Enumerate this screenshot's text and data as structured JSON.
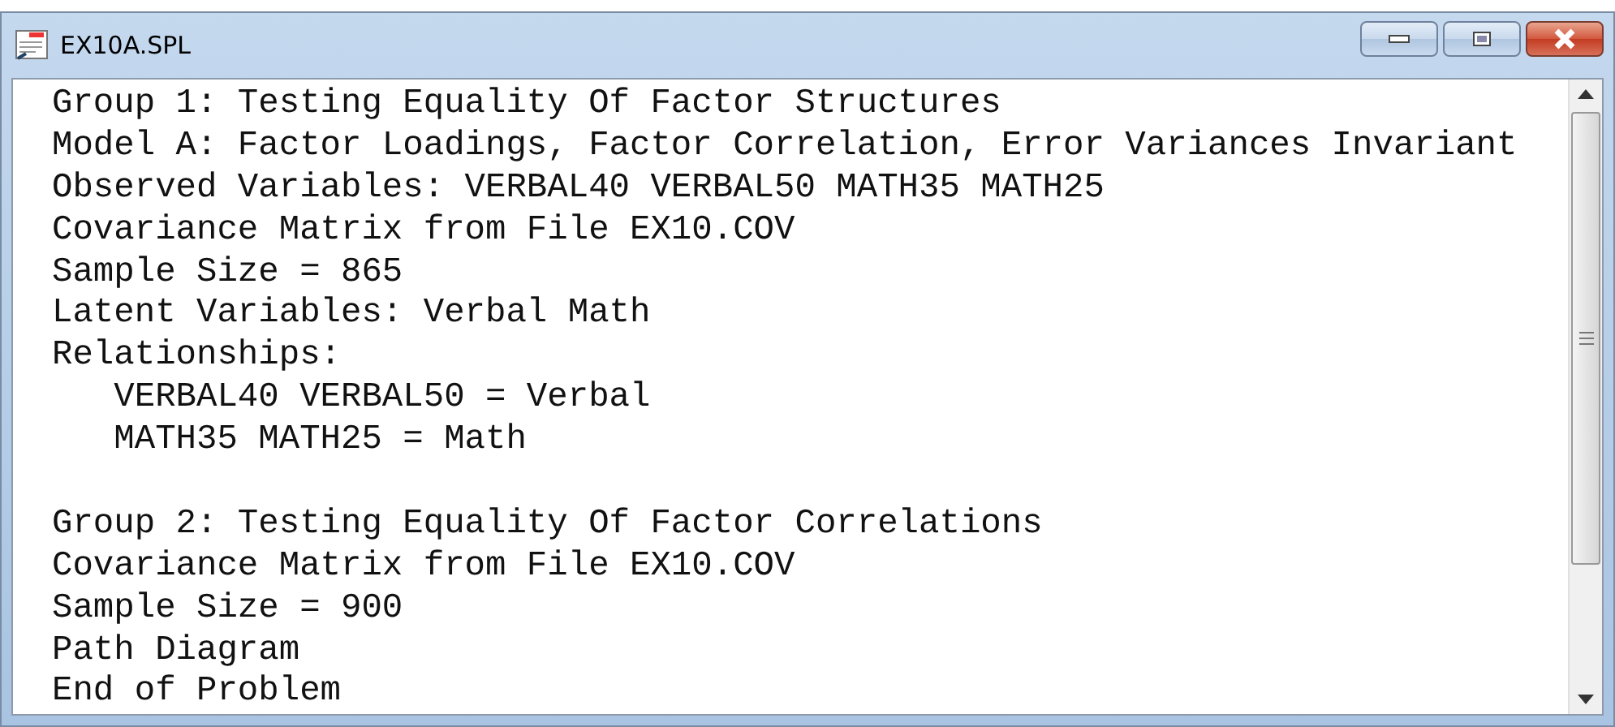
{
  "window": {
    "title": "EX10A.SPL"
  },
  "lines": [
    {
      "kind": "text",
      "text": "Group 1: Testing Equality Of Factor Structures"
    },
    {
      "kind": "text",
      "text": "Model A: Factor Loadings, Factor Correlation, Error Variances Invariant"
    },
    {
      "kind": "text",
      "text": "Observed Variables: VERBAL40 VERBAL50 MATH35 MATH25"
    },
    {
      "kind": "text",
      "text": "Covariance Matrix from File EX10.COV"
    },
    {
      "kind": "text",
      "text": "Sample Size = 865"
    },
    {
      "kind": "text",
      "text": "Latent Variables: Verbal Math"
    },
    {
      "kind": "text",
      "text": "Relationships:"
    },
    {
      "kind": "text",
      "text": "   VERBAL40 VERBAL50 = Verbal"
    },
    {
      "kind": "text",
      "text": "   MATH35 MATH25 = Math"
    },
    {
      "kind": "blank"
    },
    {
      "kind": "text",
      "text": "Group 2: Testing Equality Of Factor Correlations"
    },
    {
      "kind": "text",
      "text": "Covariance Matrix from File EX10.COV"
    },
    {
      "kind": "text",
      "text": "Sample Size = 900"
    },
    {
      "kind": "text",
      "text": "Path Diagram"
    },
    {
      "kind": "text",
      "text": "End of Problem"
    }
  ]
}
